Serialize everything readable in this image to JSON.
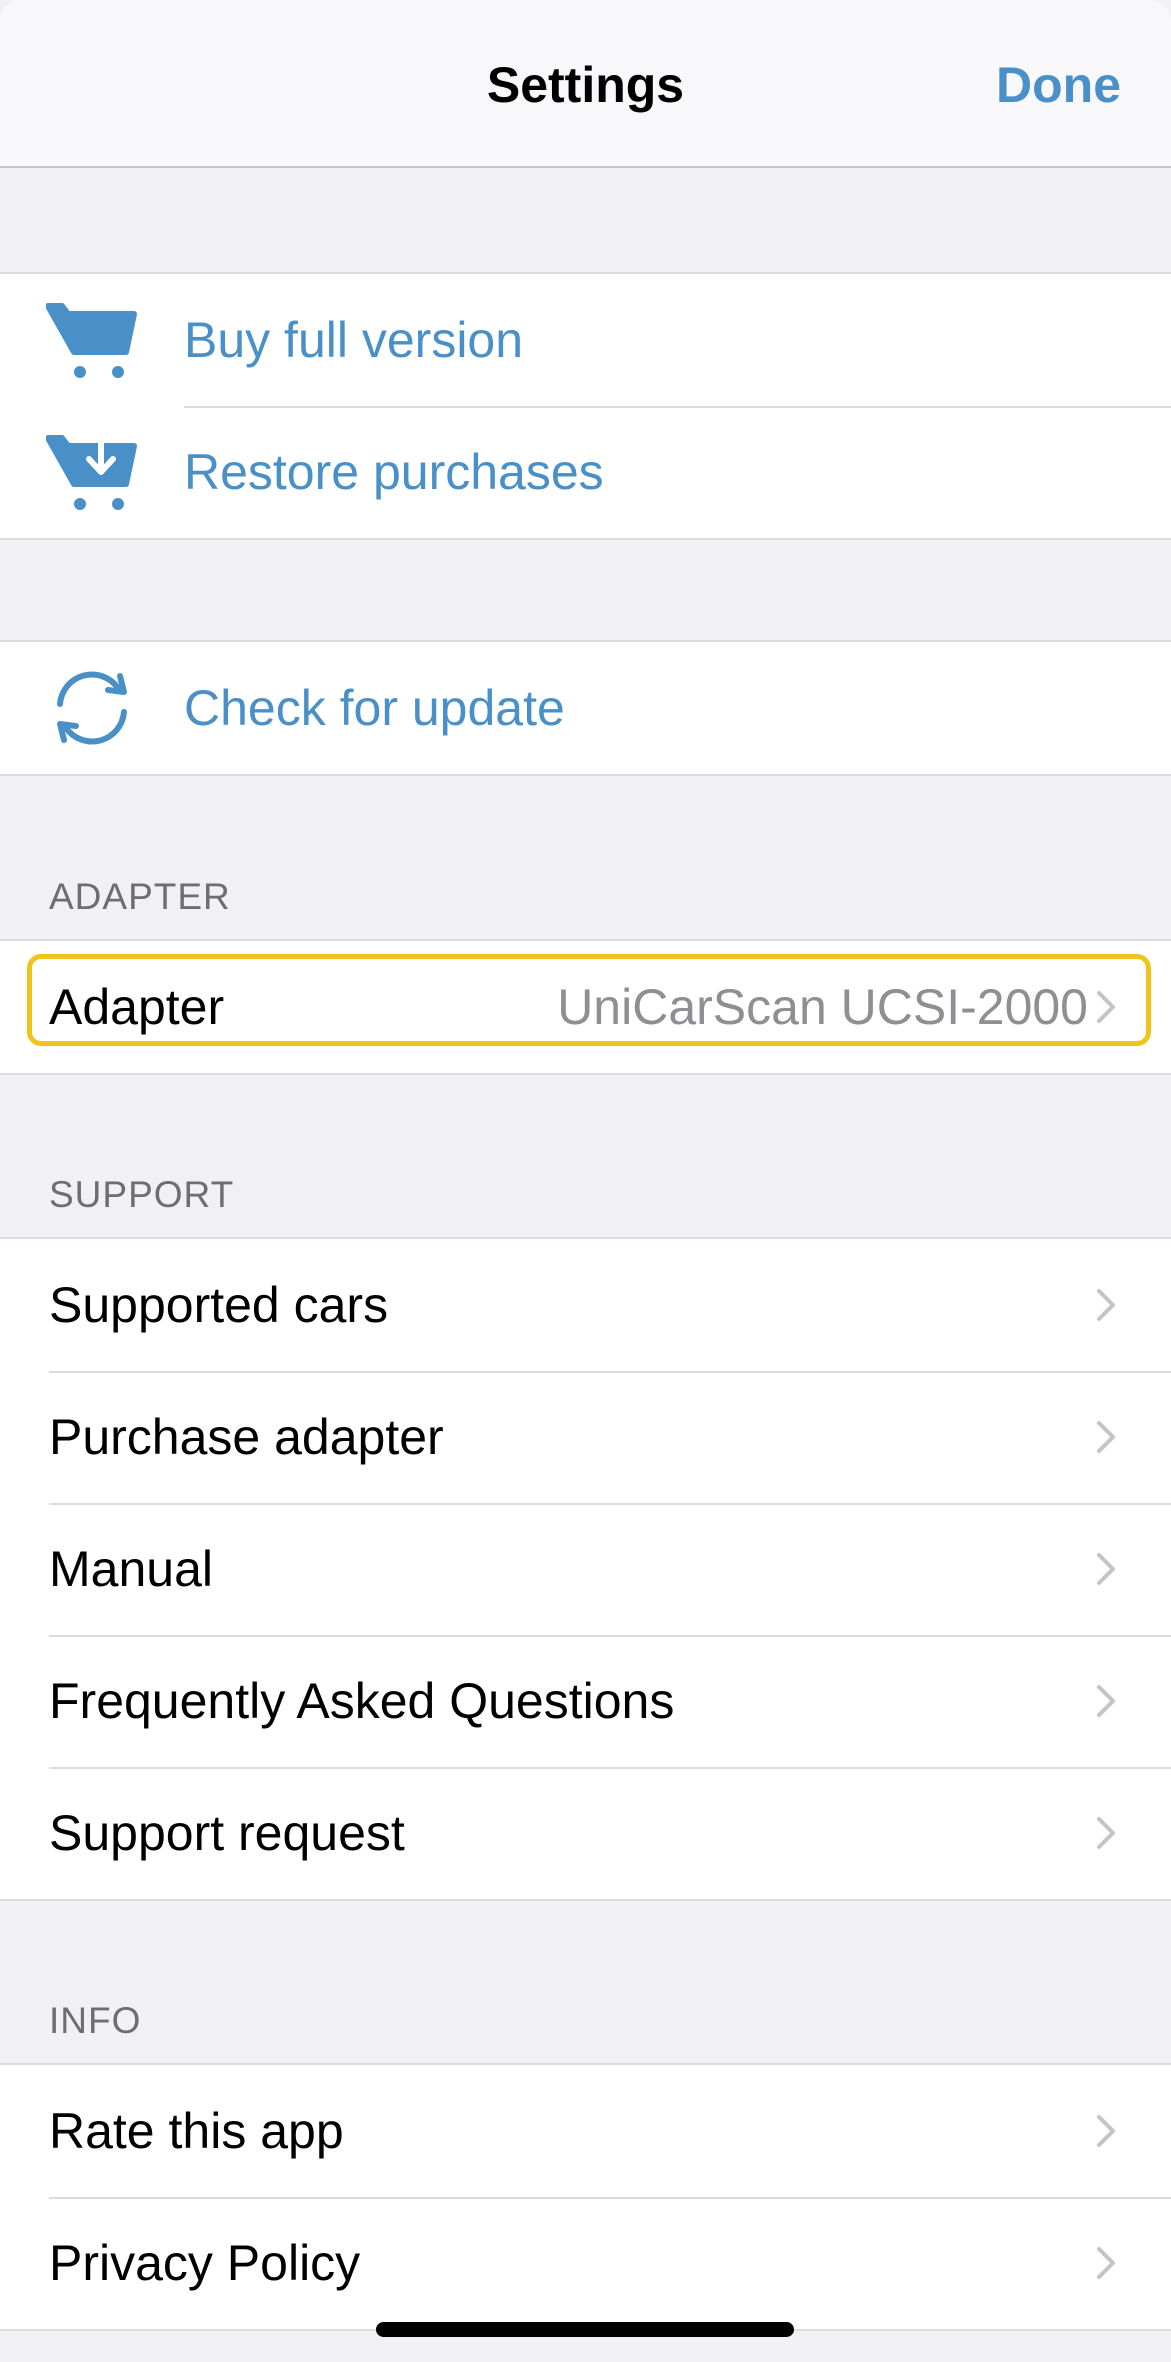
{
  "navbar": {
    "title": "Settings",
    "done_label": "Done"
  },
  "purchase_group": {
    "items": [
      {
        "label": "Buy full version",
        "icon": "cart-icon"
      },
      {
        "label": "Restore purchases",
        "icon": "cart-download-icon"
      }
    ]
  },
  "update_group": {
    "items": [
      {
        "label": "Check for update",
        "icon": "refresh-icon"
      }
    ]
  },
  "adapter_section": {
    "header": "ADAPTER",
    "items": [
      {
        "label": "Adapter",
        "value": "UniCarScan UCSI-2000"
      }
    ]
  },
  "support_section": {
    "header": "SUPPORT",
    "items": [
      {
        "label": "Supported cars"
      },
      {
        "label": "Purchase adapter"
      },
      {
        "label": "Manual"
      },
      {
        "label": "Frequently Asked Questions"
      },
      {
        "label": "Support request"
      }
    ]
  },
  "info_section": {
    "header": "INFO",
    "items": [
      {
        "label": "Rate this app"
      },
      {
        "label": "Privacy Policy"
      }
    ]
  },
  "colors": {
    "accent": "#4a90c8",
    "background": "#f0f0f5",
    "focus": "#f0c419",
    "secondary_text": "#8e8e93"
  }
}
